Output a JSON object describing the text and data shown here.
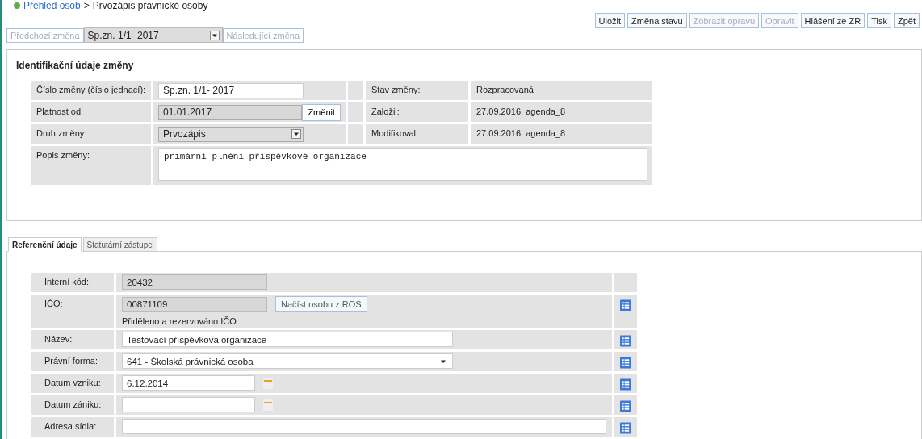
{
  "breadcrumb": {
    "link": "Přehled osob",
    "separator": ">",
    "title": "Prvozápis právnické osoby"
  },
  "toolbar": [
    {
      "label": "Uložit",
      "disabled": false
    },
    {
      "label": "Změna stavu",
      "disabled": false
    },
    {
      "label": "Zobrazit opravu",
      "disabled": true
    },
    {
      "label": "Opravit",
      "disabled": true
    },
    {
      "label": "Hlášení ze ZR",
      "disabled": false
    },
    {
      "label": "Tisk",
      "disabled": false
    },
    {
      "label": "Zpět",
      "disabled": false
    }
  ],
  "change_nav": {
    "previous": {
      "label": "Předchozí změna",
      "disabled": true
    },
    "select": {
      "value": "Sp.zn. 1/1- 2017"
    },
    "next": {
      "label": "Následující změna",
      "disabled": true
    }
  },
  "change_section": {
    "title": "Identifikační údaje změny",
    "rows": [
      {
        "label": "Číslo změny (číslo jednací):",
        "field": {
          "kind": "text",
          "value": "Sp.zn. 1/1- 2017"
        },
        "side_label": "Stav změny:",
        "side_value": "Rozpracovaná"
      },
      {
        "label": "Platnost od:",
        "field": {
          "kind": "readonly",
          "value": "01.01.2017",
          "button": "Změnit"
        },
        "side_label": "Založil:",
        "side_value": "27.09.2016, agenda_8"
      },
      {
        "label": "Druh změny:",
        "field": {
          "kind": "select",
          "value": "Prvozápis"
        },
        "side_label": "Modifikoval:",
        "side_value": "27.09.2016, agenda_8"
      }
    ],
    "description": {
      "label": "Popis změny:",
      "value": "primární plnění příspěvkové organizace"
    }
  },
  "tabs": [
    {
      "label": "Referenční údaje",
      "selected": true
    },
    {
      "label": "Statutární zástupci",
      "selected": false
    }
  ],
  "attributes": [
    {
      "label": "Interní kód:",
      "kind": "readonly",
      "value": "20432",
      "history": false
    },
    {
      "label": "IČO:",
      "kind": "readonly",
      "value": "00871109",
      "button": "Načíst osobu z ROS",
      "note": "Přiděleno a rezervováno IČO",
      "history": true
    },
    {
      "label": "Název:",
      "kind": "text",
      "value": "Testovací příspěvková organizace",
      "history": true
    },
    {
      "label": "Právní forma:",
      "kind": "select",
      "value": "641 - Školská právnická osoba",
      "history": true
    },
    {
      "label": "Datum vzniku:",
      "kind": "date",
      "value": "6.12.2014",
      "history": true
    },
    {
      "label": "Datum zániku:",
      "kind": "date",
      "history": true
    },
    {
      "label": "Adresa sídla:",
      "kind": "wide",
      "history": true
    }
  ]
}
